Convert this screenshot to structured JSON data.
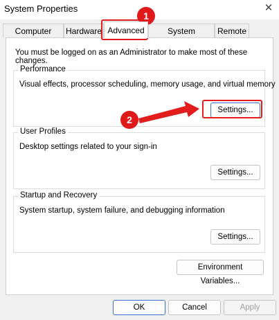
{
  "window": {
    "title": "System Properties",
    "close_glyph": "✕"
  },
  "tabs": [
    {
      "label": "Computer Name"
    },
    {
      "label": "Hardware"
    },
    {
      "label": "Advanced"
    },
    {
      "label": "System Protection"
    },
    {
      "label": "Remote"
    }
  ],
  "active_tab": "Advanced",
  "notice": "You must be logged on as an Administrator to make most of these changes.",
  "groups": {
    "performance": {
      "title": "Performance",
      "description": "Visual effects, processor scheduling, memory usage, and virtual memory",
      "button": "Settings..."
    },
    "user_profiles": {
      "title": "User Profiles",
      "description": "Desktop settings related to your sign-in",
      "button": "Settings..."
    },
    "startup_recovery": {
      "title": "Startup and Recovery",
      "description": "System startup, system failure, and debugging information",
      "button": "Settings..."
    }
  },
  "env_button": "Environment Variables...",
  "footer": {
    "ok": "OK",
    "cancel": "Cancel",
    "apply": "Apply"
  },
  "annotations": {
    "step1": "1",
    "step2": "2",
    "highlight_color": "#e21d1d"
  }
}
